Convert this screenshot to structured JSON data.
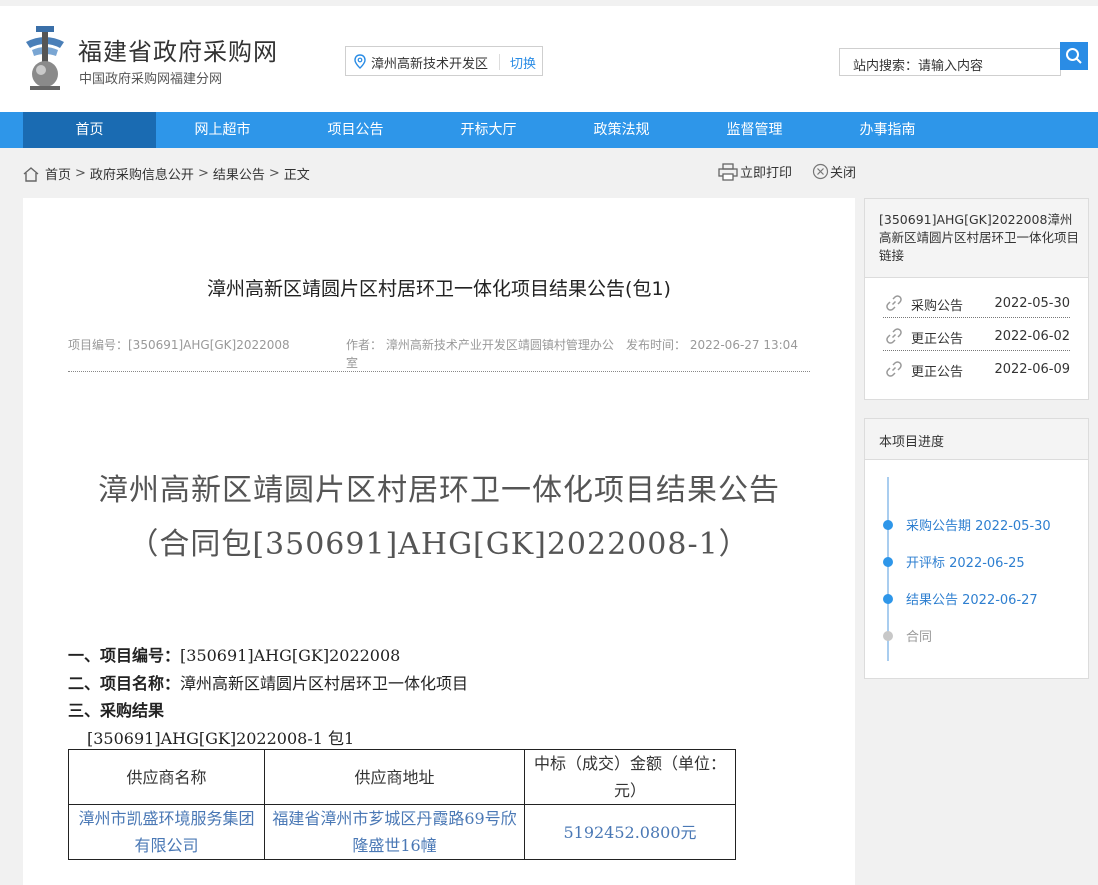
{
  "header": {
    "site_title": "福建省政府采购网",
    "site_subtitle": "中国政府采购网福建分网",
    "region": "漳州高新技术开发区",
    "region_switch": "切换",
    "search_label": "站内搜索：请输入内容"
  },
  "nav": {
    "items": [
      "首页",
      "网上超市",
      "项目公告",
      "开标大厅",
      "政策法规",
      "监督管理",
      "办事指南"
    ],
    "active": "首页"
  },
  "breadcrumb": {
    "items": [
      "首页",
      "政府采购信息公开",
      "结果公告",
      "正文"
    ],
    "separator": ">"
  },
  "actions": {
    "print": "立即打印",
    "close": "关闭"
  },
  "article": {
    "title": "漳州高新区靖圆片区村居环卫一体化项目结果公告(包1)",
    "meta": {
      "project_no": "项目编号：[350691]AHG[GK]2022008",
      "author": "作者：  漳州高新技术产业开发区靖圆镇村管理办公室",
      "publish_time": "发布时间：  2022-06-27 13:04"
    },
    "big_title_line1": "漳州高新区靖圆片区村居环卫一体化项目结果公告",
    "big_title_line2": "（合同包[350691]AHG[GK]2022008-1）",
    "section1_label": "一、项目编号：",
    "section1_value": "[350691]AHG[GK]2022008",
    "section2_label": "二、项目名称：",
    "section2_value": "漳州高新区靖圆片区村居环卫一体化项目",
    "section3_label": "三、采购结果",
    "package_line": "[350691]AHG[GK]2022008-1 包1",
    "table": {
      "headers": [
        "供应商名称",
        "供应商地址",
        "中标（成交）金额（单位：元）"
      ],
      "rows": [
        [
          "漳州市凯盛环境服务集团有限公司",
          "福建省漳州市芗城区丹霞路69号欣隆盛世16幢",
          "5192452.0800元"
        ]
      ]
    }
  },
  "sidebar": {
    "project_title": "[350691]AHG[GK]2022008漳州高新区靖圆片区村居环卫一体化项目链接",
    "links": [
      {
        "label": "采购公告",
        "date": "2022-05-30"
      },
      {
        "label": "更正公告",
        "date": "2022-06-02"
      },
      {
        "label": "更正公告",
        "date": "2022-06-09"
      }
    ],
    "progress_title": "本项目进度",
    "progress": [
      {
        "label": "采购公告期 2022-05-30",
        "done": true
      },
      {
        "label": "开评标 2022-06-25",
        "done": true
      },
      {
        "label": "结果公告 2022-06-27",
        "done": true
      },
      {
        "label": "合同",
        "done": false
      }
    ]
  },
  "colors": {
    "nav_bg": "#2e96e9",
    "nav_active": "#1a6bb2",
    "accent": "#2a8ce5"
  }
}
